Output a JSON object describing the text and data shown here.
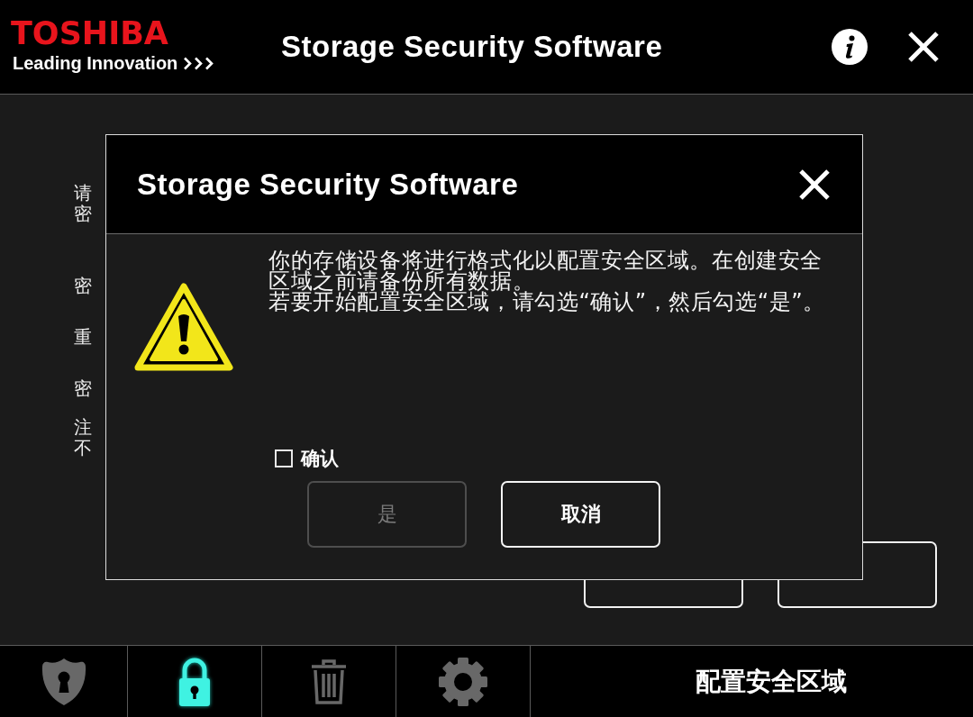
{
  "header": {
    "brand": "TOSHIBA",
    "tagline": "Leading Innovation",
    "title": "Storage Security Software"
  },
  "form": {
    "labels": [
      "请密",
      "密",
      "重",
      "密",
      "注不"
    ],
    "buttons": [
      {
        "disabled": false
      },
      {
        "disabled": false
      }
    ]
  },
  "dialog": {
    "title": "Storage Security Software",
    "message": [
      "你的存储设备将进行格式化以配置安全区域。在创建安全区域之前请备份所有数据。",
      "若要开始配置安全区域，请勾选“确认”，然后勾选“是”。"
    ],
    "confirm": {
      "label": "确认",
      "checked": false
    },
    "buttons": [
      {
        "label": "是",
        "disabled": true
      },
      {
        "label": "取消",
        "disabled": false
      }
    ]
  },
  "footer": {
    "tabs": [
      {
        "selected": false
      },
      {
        "selected": true
      },
      {
        "selected": false
      },
      {
        "selected": false
      }
    ],
    "label": "配置安全区域"
  }
}
